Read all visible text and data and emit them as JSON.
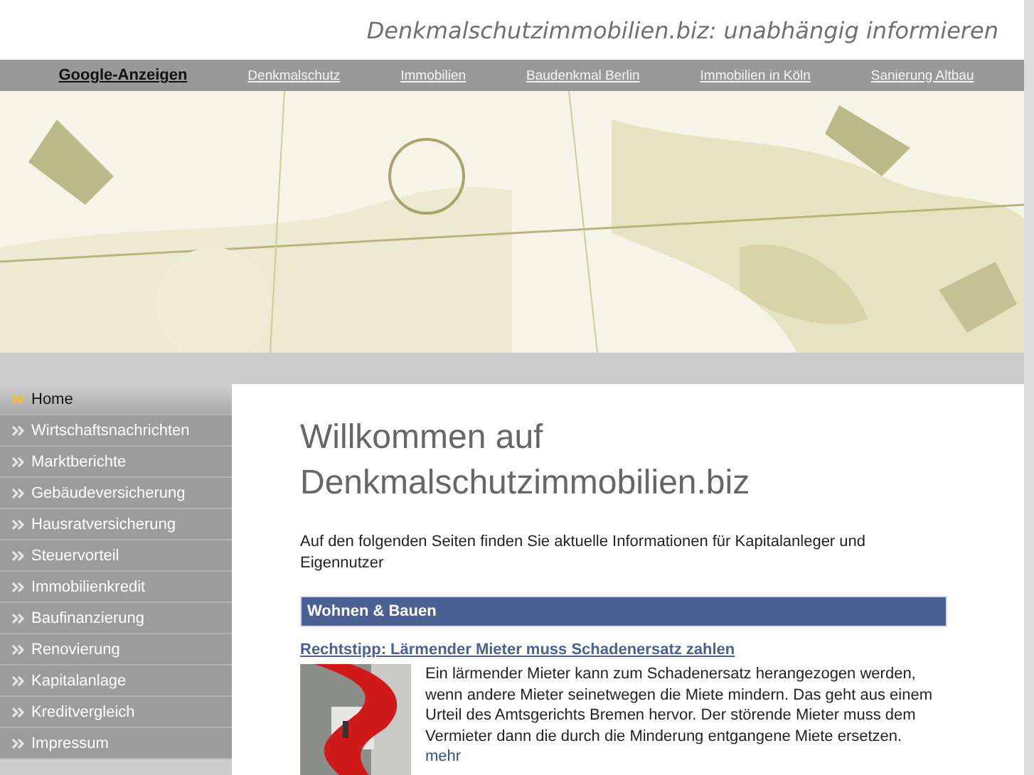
{
  "site_title": "Denkmalschutzimmobilien.biz: unabhängig informieren",
  "nav": {
    "label": "Google-Anzeigen",
    "links": [
      "Denkmalschutz",
      "Immobilien",
      "Baudenkmal Berlin",
      "Immobilien in Köln",
      "Sanierung Altbau"
    ]
  },
  "sidebar": {
    "items": [
      {
        "label": "Home",
        "selected": true
      },
      {
        "label": "Wirtschaftsnachrichten",
        "selected": false
      },
      {
        "label": "Marktberichte",
        "selected": false
      },
      {
        "label": "Gebäudeversicherung",
        "selected": false
      },
      {
        "label": "Hausratversicherung",
        "selected": false
      },
      {
        "label": "Steuervorteil",
        "selected": false
      },
      {
        "label": "Immobilienkredit",
        "selected": false
      },
      {
        "label": "Baufinanzierung",
        "selected": false
      },
      {
        "label": "Renovierung",
        "selected": false
      },
      {
        "label": "Kapitalanlage",
        "selected": false
      },
      {
        "label": "Kreditvergleich",
        "selected": false
      },
      {
        "label": "Impressum",
        "selected": false
      }
    ]
  },
  "main": {
    "heading": "Willkommen auf Denkmalschutzimmobilien.biz",
    "intro": "Auf den folgenden Seiten finden Sie aktuelle Informationen für Kapitalanleger und Eigennutzer",
    "section": "Wohnen & Bauen",
    "article": {
      "title": "Rechtstipp: Lärmender Mieter muss Schadenersatz zahlen",
      "text": "Ein lärmender Mieter kann zum Schadenersatz herangezogen werden, wenn andere Mieter seinetwegen die Miete mindern. Das geht aus einem Urteil des Amtsgerichts Bremen hervor. Der störende Mieter muss dem Vermieter dann die durch die Minderung entgangene Miete ersetzen.",
      "more": "mehr"
    }
  }
}
